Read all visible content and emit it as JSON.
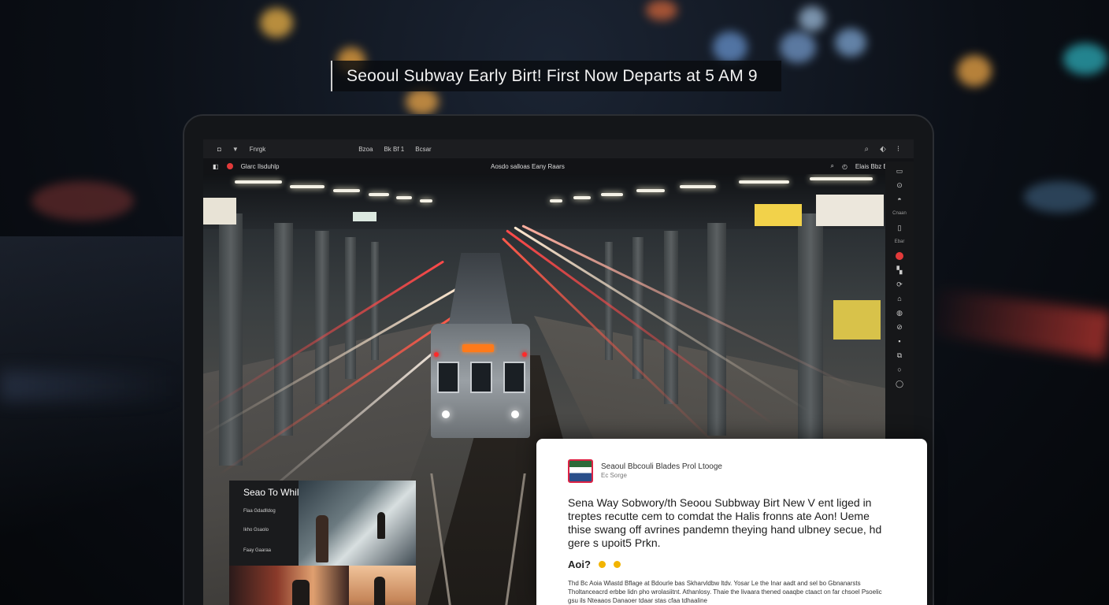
{
  "headline": "Seooul Subway Early Birt! First Now Departs at 5 AM  9",
  "browser": {
    "tab_title": "Fnrgk",
    "tabs": [
      "Bzoa",
      "Bk Bf 1",
      "Bcsar"
    ]
  },
  "site": {
    "brand": "Glarc Ilsduhlp",
    "page_title": "Aosdo salloas Eany Raars",
    "account_label": "Elais Bbz Bz"
  },
  "toolbar": {
    "label_1": "Cnaan",
    "label_2": "Ebar"
  },
  "gallery": {
    "title": "Seao To Whiliagnerg INE?",
    "lines": [
      "Flaa Gdadlldog",
      "Ikho Gsaolo",
      "Faay Gaaraa"
    ]
  },
  "article": {
    "source": "Seaoul Bbcouli Blades Prol Ltooge",
    "source_sub": "Ec Sorge",
    "body": "Sena Way Sobwory/th Seoou Subbway Birt New V ent liged in treptes recutte cem to comdat the Halis fronns ate Aon! Ueme thise swang off avrines pandemn theying hand ulbney secue, hd gere s upoit5 Prkn.",
    "section": "Aoi?",
    "small": "Thd Bc Aoia Wlastd Bflage at Bdourle bas Skharvldbw ltdv. Yosar Le the Inar aadt and sel bo Gbnanarsts Tholtanceacrd erbbe lidn pho wrolasiitnt. Athanlosy. Thaie the livaara thened oaaqbe ctaact on far chsoel Psoelic gsu ils Nteaaos Danaoer tdaar stas cfaa tdhaaline"
  },
  "colors": {
    "accent_red": "#e23a3a",
    "accent_yellow": "#f2b400",
    "destination_orange": "#ff7a1a"
  }
}
